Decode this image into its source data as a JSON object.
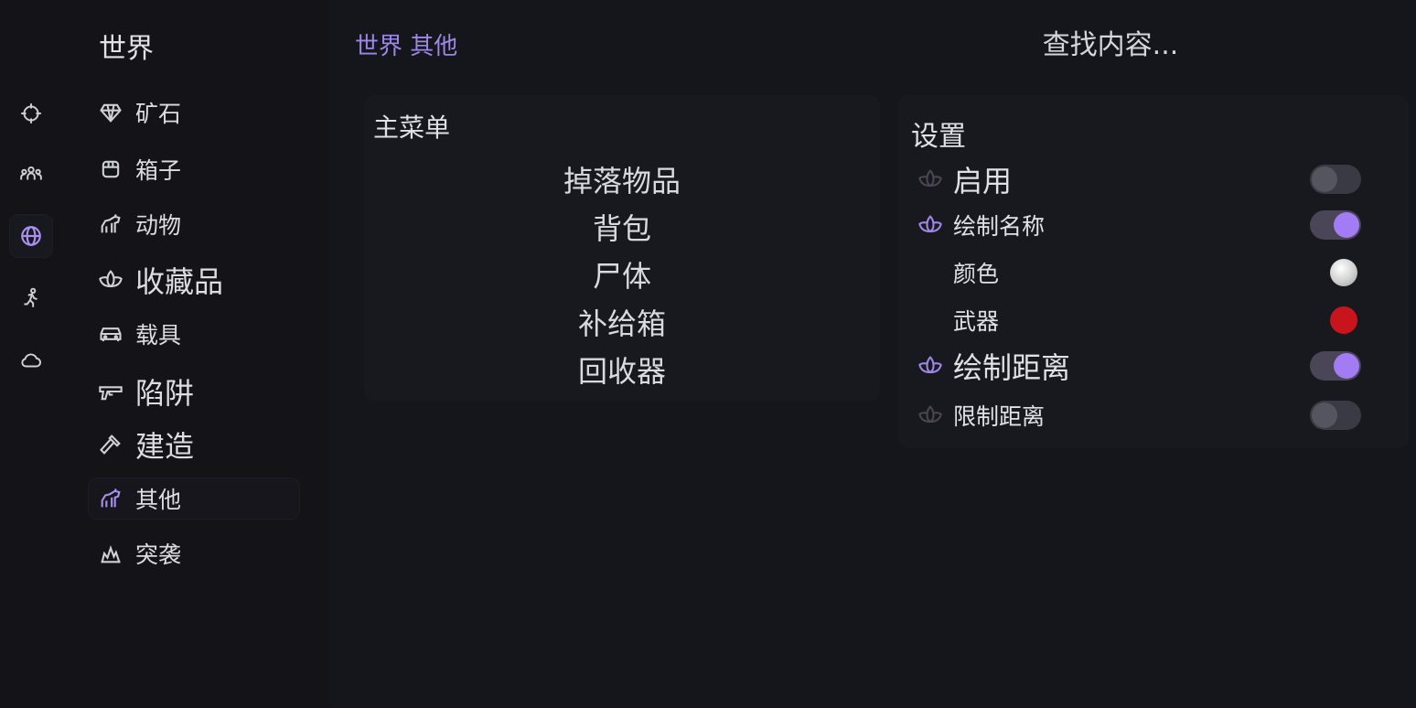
{
  "rail": {
    "items": [
      {
        "name": "crosshair-icon",
        "active": false
      },
      {
        "name": "players-icon",
        "active": false
      },
      {
        "name": "globe-icon",
        "active": true
      },
      {
        "name": "running-icon",
        "active": false
      },
      {
        "name": "cloud-icon",
        "active": false
      }
    ]
  },
  "sidebar": {
    "title": "世界",
    "items": [
      {
        "label": "矿石",
        "icon": "gem-icon"
      },
      {
        "label": "箱子",
        "icon": "box-icon"
      },
      {
        "label": "动物",
        "icon": "horse-icon"
      },
      {
        "label": "收藏品",
        "icon": "lotus-icon"
      },
      {
        "label": "载具",
        "icon": "car-icon"
      },
      {
        "label": "陷阱",
        "icon": "gun-icon"
      },
      {
        "label": "建造",
        "icon": "hammer-icon"
      },
      {
        "label": "其他",
        "icon": "horse-icon",
        "active": true
      },
      {
        "label": "突袭",
        "icon": "explosion-icon"
      }
    ]
  },
  "header": {
    "breadcrumb": "世界 其他",
    "search_placeholder": "查找内容..."
  },
  "menu": {
    "title": "主菜单",
    "items": [
      "掉落物品",
      "背包",
      "尸体",
      "补给箱",
      "回收器"
    ]
  },
  "settings": {
    "title": "设置",
    "rows": [
      {
        "label": "启用",
        "type": "toggle",
        "value": false
      },
      {
        "label": "绘制名称",
        "type": "toggle",
        "value": true
      },
      {
        "label": "颜色",
        "type": "color",
        "value": "#e8e8e8"
      },
      {
        "label": "武器",
        "type": "color",
        "value": "#c8141c"
      },
      {
        "label": "绘制距离",
        "type": "toggle",
        "value": true
      },
      {
        "label": "限制距离",
        "type": "toggle",
        "value": false
      }
    ]
  },
  "colors": {
    "accent": "#a27cf4",
    "background": "#131318",
    "panel": "#18181f"
  }
}
